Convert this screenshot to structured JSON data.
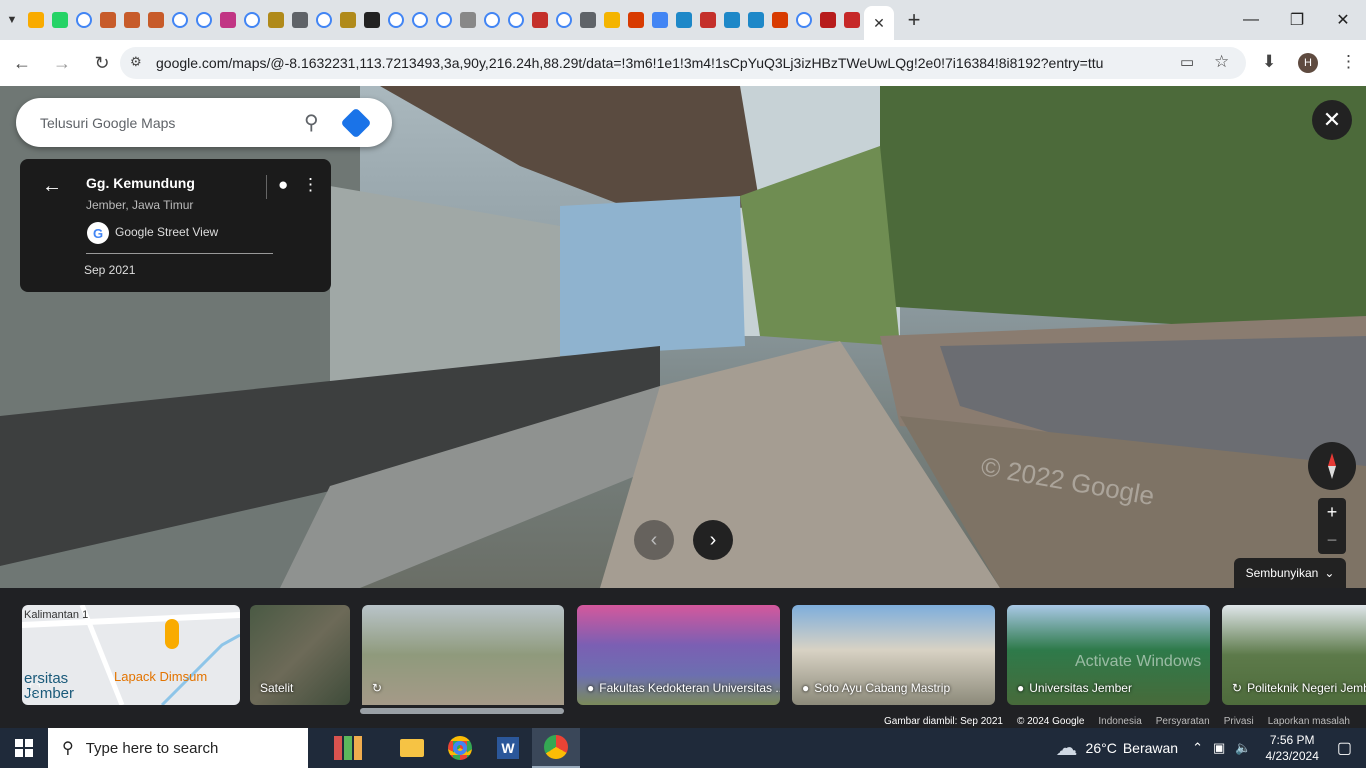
{
  "browser": {
    "tab_count_icons": [
      "chart",
      "whatsapp",
      "google",
      "jdih",
      "jdih",
      "jdih",
      "google",
      "google",
      "instagram",
      "google",
      "emblem",
      "doc",
      "google",
      "emblem",
      "ro",
      "google",
      "google",
      "google",
      "ask",
      "google",
      "google",
      "youtube",
      "google",
      "globe",
      "photo",
      "office",
      "docs",
      "sso",
      "notion",
      "sso",
      "linear",
      "office",
      "google",
      "ti",
      "r"
    ],
    "new_tab_label": "+",
    "url": "google.com/maps/@-8.1632231,113.7213493,3a,90y,216.24h,88.29t/data=!3m6!1e1!3m4!1sCpYuQ3Lj3izHBzTWeUwLQg!2e0!7i16384!8i8192?entry=ttu",
    "profile_initial": "H"
  },
  "maps": {
    "search_placeholder": "Telusuri Google Maps",
    "place_title": "Gg. Kemundung",
    "place_subtitle": "Jember, Jawa Timur",
    "source": "Google Street View",
    "date": "Sep 2021",
    "hide_label": "Sembunyikan",
    "watermark": "© 2022 Google",
    "zoom_in": "+",
    "zoom_out": "−"
  },
  "filmstrip": {
    "map_labels": {
      "street": "Kalimantan 1",
      "campus": "ersitas\nJember",
      "poi": "Lapack Dimsum"
    },
    "items": [
      {
        "label": "Satelit"
      },
      {
        "label": ""
      },
      {
        "label": "Fakultas Kedokteran Universitas ..."
      },
      {
        "label": "Soto Ayu Cabang Mastrip"
      },
      {
        "label": "Universitas Jember"
      },
      {
        "label": "Politeknik Negeri Jember"
      }
    ],
    "watermark": "Activate Windows"
  },
  "footer": {
    "captured": "Gambar diambil: Sep 2021",
    "copyright": "© 2024 Google",
    "country": "Indonesia",
    "terms": "Persyaratan",
    "privacy": "Privasi",
    "report": "Laporkan masalah"
  },
  "taskbar": {
    "search_placeholder": "Type here to search",
    "weather_temp": "26°C",
    "weather_desc": "Berawan",
    "time": "7:56 PM",
    "date": "4/23/2024"
  }
}
